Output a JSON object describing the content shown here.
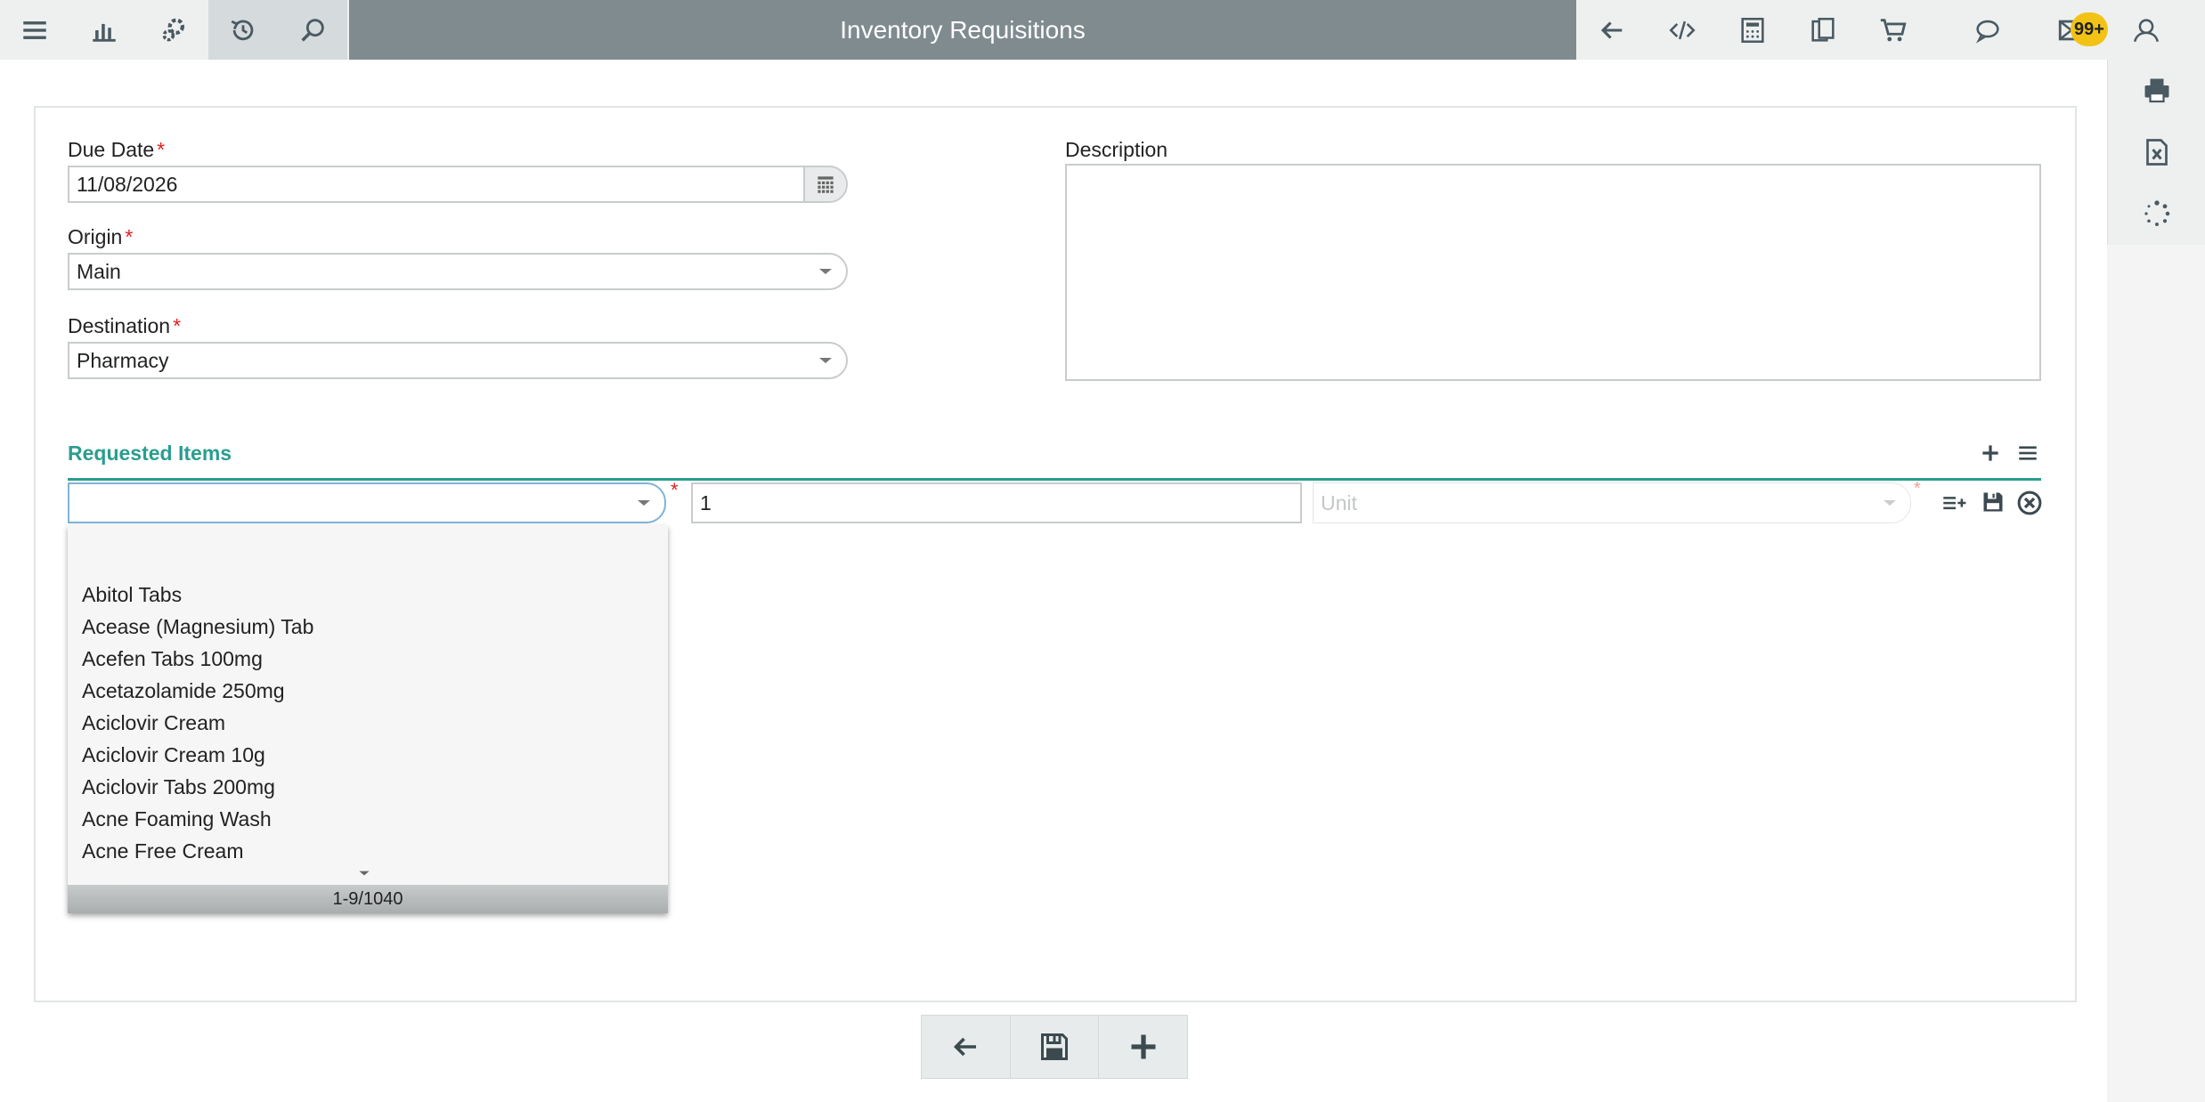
{
  "header": {
    "title": "Inventory Requisitions",
    "left_icons": [
      "menu-icon",
      "chart-icon",
      "settings-icon",
      "history-icon",
      "search-icon"
    ],
    "right_icons": [
      "back-icon",
      "code-icon",
      "calculator-icon",
      "copy-icon",
      "cart-icon"
    ],
    "far_icons": [
      "chat-icon",
      "mail-icon",
      "user-icon"
    ],
    "notification_count": "99+"
  },
  "side_tools": [
    "print-icon",
    "excel-icon",
    "loading-icon"
  ],
  "form": {
    "due_date_label": "Due Date",
    "due_date_value": "11/08/2026",
    "origin_label": "Origin",
    "origin_value": "Main",
    "destination_label": "Destination",
    "destination_value": "Pharmacy",
    "description_label": "Description",
    "required_mark": "*"
  },
  "requested_items": {
    "title": "Requested Items",
    "item_value": "",
    "quantity_value": "1",
    "unit_placeholder": "Unit"
  },
  "dropdown": {
    "items": [
      "Abitol Tabs",
      "Acease (Magnesium) Tab",
      "Acefen Tabs 100mg",
      "Acetazolamide 250mg",
      "Aciclovir Cream",
      "Aciclovir Cream 10g",
      "Aciclovir Tabs 200mg",
      "Acne Foaming Wash",
      "Acne Free Cream"
    ],
    "pager": "1-9/1040"
  },
  "colors": {
    "accent": "#2a9d8f",
    "topbar": "#7f8b8f",
    "badge": "#f2c315",
    "required": "#e02020"
  }
}
